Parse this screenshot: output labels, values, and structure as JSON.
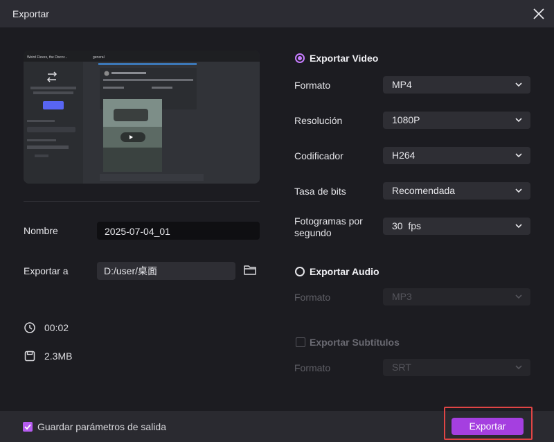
{
  "window": {
    "title": "Exportar"
  },
  "preview": {
    "server_name": "Weird Flexes, the Discor...",
    "channel": "general",
    "quick_switcher_text": "Use Quick Switcher to get around Discord quickly. Just press:",
    "shortcut": "CTRL + K",
    "text_channels_header": "TEXT CHANNELS",
    "voice_channels_header": "VOICE CHANNELS",
    "voice_channel": "General",
    "message_user": "Sukkie (@Sukkie01)"
  },
  "left": {
    "name_label": "Nombre",
    "name_value": "2025-07-04_01",
    "export_to_label": "Exportar a",
    "export_path": "D:/user/桌面",
    "duration": "00:02",
    "size": "2.3MB"
  },
  "video": {
    "title": "Exportar Video",
    "format_label": "Formato",
    "format_value": "MP4",
    "resolution_label": "Resolución",
    "resolution_value": "1080P",
    "encoder_label": "Codificador",
    "encoder_value": "H264",
    "bitrate_label": "Tasa de bits",
    "bitrate_value": "Recomendada",
    "fps_label_line1": "Fotogramas por",
    "fps_label_line2": "segundo",
    "fps_value": "30  fps"
  },
  "audio": {
    "title": "Exportar Audio",
    "format_label": "Formato",
    "format_value": "MP3"
  },
  "subtitles": {
    "title": "Exportar Subtítulos",
    "format_label": "Formato",
    "format_value": "SRT"
  },
  "footer": {
    "save_params_label": "Guardar parámetros de salida",
    "export_button": "Exportar"
  },
  "colors": {
    "accent": "#a53fe0",
    "radio_accent": "#c77dff",
    "highlight": "#e04545"
  }
}
